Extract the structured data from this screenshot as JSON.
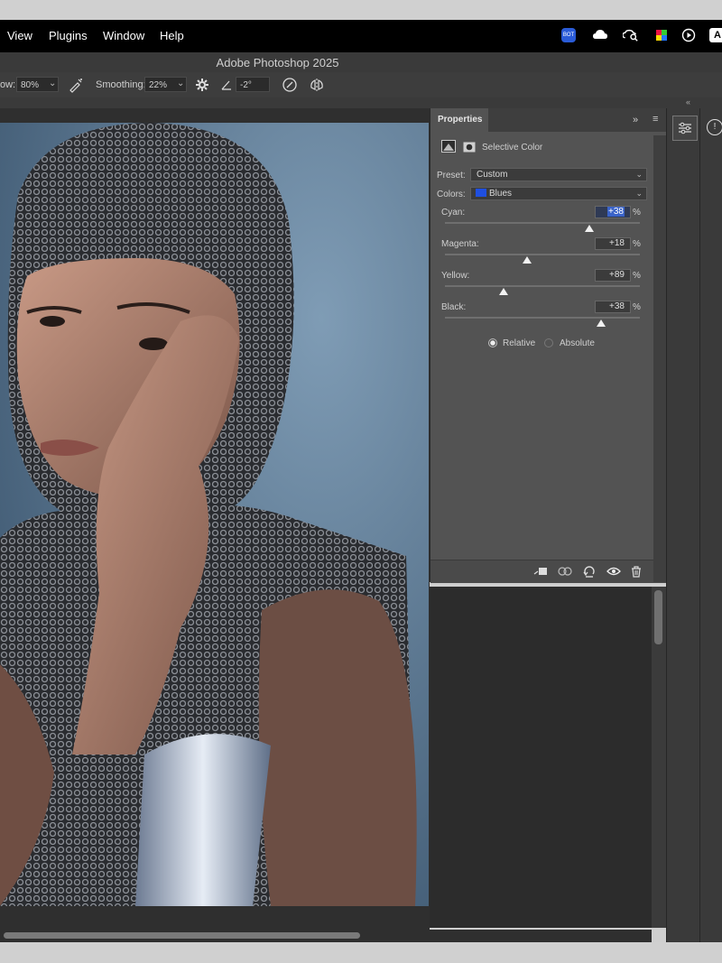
{
  "menu": {
    "items": [
      "View",
      "Plugins",
      "Window",
      "Help"
    ],
    "tray_badge": "BOT",
    "tray_last": "A"
  },
  "window": {
    "title": "Adobe Photoshop 2025"
  },
  "options_bar": {
    "flow_label": "ow:",
    "flow_value": "80%",
    "smoothing_label": "Smoothing:",
    "smoothing_value": "22%",
    "angle_value": "-2°"
  },
  "properties_panel": {
    "tab_label": "Properties",
    "adjustment_title": "Selective Color",
    "preset_label": "Preset:",
    "preset_value": "Custom",
    "colors_label": "Colors:",
    "colors_value": "Blues",
    "colors_swatch": "#1f4fe0",
    "sliders": [
      {
        "label": "Cyan:",
        "value": "+38",
        "position": 0.74
      },
      {
        "label": "Magenta:",
        "value": "+18",
        "position": 0.42
      },
      {
        "label": "Yellow:",
        "value": "+89",
        "position": 0.3
      },
      {
        "label": "Black:",
        "value": "+38",
        "position": 0.8
      }
    ],
    "percent_sign": "%",
    "method_relative": "Relative",
    "method_absolute": "Absolute",
    "method_selected": "relative"
  },
  "colors": {
    "accent": "#2a5bd7",
    "panel_bg": "#535353",
    "menubar_bg": "#000000"
  }
}
